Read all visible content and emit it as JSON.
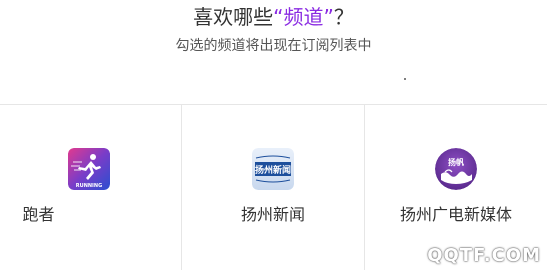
{
  "header": {
    "title_prefix": "喜欢哪些",
    "title_quoted": "“频道”",
    "title_suffix": "？",
    "subtitle": "勾选的频道将出现在订阅列表中"
  },
  "channels": [
    {
      "name": "跑者",
      "icon": "runner-logo-icon",
      "logo_text": "RUNNING"
    },
    {
      "name": "扬州新闻",
      "icon": "yangzhou-news-logo-icon",
      "logo_text": "扬州新闻"
    },
    {
      "name": "扬州广电新媒体",
      "icon": "yangfan-logo-icon",
      "logo_text": "扬帆"
    }
  ],
  "watermark": "QQTF.COM",
  "colors": {
    "accent": "#8a2be2",
    "text": "#333333",
    "divider": "#e6e6e6"
  }
}
